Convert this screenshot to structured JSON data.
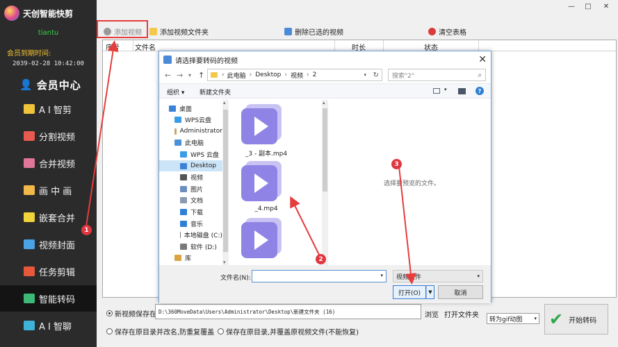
{
  "app": {
    "title": "天创智能快剪",
    "username": "tiantu",
    "expire_label": "会员到期时间:",
    "expire_time": "2039-02-28 10:42:00",
    "member_center": "会员中心",
    "window_controls": {
      "minimize": "—",
      "maximize": "□",
      "close": "✕"
    }
  },
  "sidebar": {
    "items": [
      {
        "label": "A I 智剪",
        "icon": "ai-cut-icon",
        "color": "#f0c43a"
      },
      {
        "label": "分割视频",
        "icon": "split-video-icon",
        "color": "#e85a4f"
      },
      {
        "label": "合并视频",
        "icon": "merge-video-icon",
        "color": "#e0769a"
      },
      {
        "label": "画 中 画",
        "icon": "picture-in-picture-icon",
        "color": "#f2b94a"
      },
      {
        "label": "嵌套合并",
        "icon": "nest-merge-icon",
        "color": "#f0d23a"
      },
      {
        "label": "视频封面",
        "icon": "video-cover-icon",
        "color": "#4aa3e6"
      },
      {
        "label": "任务剪辑",
        "icon": "task-edit-icon",
        "color": "#e8583a"
      },
      {
        "label": "智能转码",
        "icon": "smart-transcode-icon",
        "color": "#3cb878",
        "active": true
      },
      {
        "label": "A I 智聊",
        "icon": "ai-chat-icon",
        "color": "#3fb2d8"
      }
    ]
  },
  "toolbar": {
    "add_video": "添加视频",
    "add_folder": "添加视频文件夹",
    "delete_selected": "删除已选的视频",
    "clear_table": "清空表格"
  },
  "table": {
    "columns": [
      "序号",
      "文件名",
      "时长",
      "状态"
    ]
  },
  "bottom": {
    "new_save_label": "新视频保存在:",
    "save_path": "D:\\360MoveData\\Users\\Administrator\\Desktop\\新建文件夹 (16)",
    "browse": "浏览",
    "open_folder": "打开文件夹",
    "option_rename": "保存在原目录并改名,防重复覆盖",
    "option_overwrite": "保存在原目录,并覆盖原视频文件(不能恢复)",
    "gif_select": "转为gif动图",
    "start_button": "开始转码"
  },
  "dialog": {
    "title": "请选择要转码的视频",
    "breadcrumb": [
      "此电脑",
      "Desktop",
      "视频",
      "2"
    ],
    "search_placeholder": "搜索\"2\"",
    "organize": "组织 ▾",
    "new_folder": "新建文件夹",
    "tree": [
      {
        "label": "桌面",
        "icon": "desktop-icon",
        "color": "#3b82d6",
        "indent": 0
      },
      {
        "label": "WPS云盘",
        "icon": "cloud-icon",
        "color": "#3a9de6",
        "indent": 1
      },
      {
        "label": "Administrator",
        "icon": "user-icon",
        "color": "#c9a26a",
        "indent": 1
      },
      {
        "label": "此电脑",
        "icon": "computer-icon",
        "color": "#4b8fd6",
        "indent": 1
      },
      {
        "label": "WPS 云盘",
        "icon": "cloud-icon",
        "color": "#3a9de6",
        "indent": 2
      },
      {
        "label": "Desktop",
        "icon": "desktop-icon",
        "color": "#3b82d6",
        "indent": 2,
        "selected": true
      },
      {
        "label": "视频",
        "icon": "video-folder-icon",
        "color": "#555555",
        "indent": 2
      },
      {
        "label": "图片",
        "icon": "pictures-icon",
        "color": "#6d8fbf",
        "indent": 2
      },
      {
        "label": "文档",
        "icon": "documents-icon",
        "color": "#8a9bb0",
        "indent": 2
      },
      {
        "label": "下载",
        "icon": "download-icon",
        "color": "#2f7fd6",
        "indent": 2
      },
      {
        "label": "音乐",
        "icon": "music-icon",
        "color": "#2f7fd6",
        "indent": 2
      },
      {
        "label": "本地磁盘 (C:)",
        "icon": "drive-icon",
        "color": "#7a7a7a",
        "indent": 2
      },
      {
        "label": "软件 (D:)",
        "icon": "drive-icon",
        "color": "#7a7a7a",
        "indent": 2
      },
      {
        "label": "库",
        "icon": "library-icon",
        "color": "#d9a441",
        "indent": 1
      }
    ],
    "files": [
      {
        "name": "_3 - 副本.mp4"
      },
      {
        "name": "_4.mp4"
      },
      {
        "name": ""
      }
    ],
    "preview_message": "选择要预览的文件。",
    "filename_label": "文件名(N):",
    "filter": "视频文件",
    "open_button": "打开(O)",
    "cancel_button": "取消"
  },
  "annotations": [
    "1",
    "2",
    "3"
  ],
  "colors": {
    "sidebar_bg": "#2b2b2b",
    "accent_red": "#e53c3c",
    "play_purple": "#8f84e6"
  }
}
